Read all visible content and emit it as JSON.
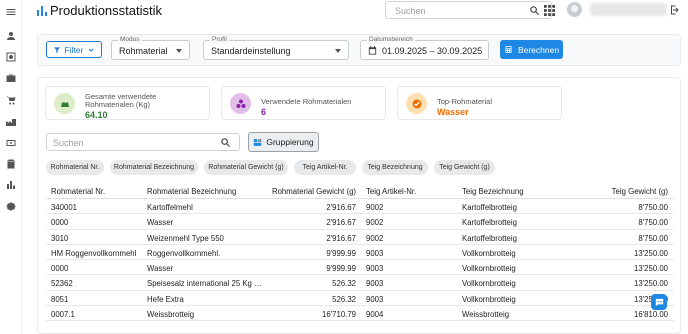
{
  "header": {
    "title": "Produktionsstatistik",
    "search_placeholder": "Suchen"
  },
  "filters": {
    "filter_label": "Filter",
    "modus": {
      "label": "Modus",
      "value": "Rohmaterial"
    },
    "profil": {
      "label": "Profil",
      "value": "Standardeinstellung"
    },
    "datumsbereich": {
      "label": "Datumsbereich",
      "value": "01.09.2025 – 30.09.2025"
    },
    "calculate_label": "Berechnen"
  },
  "stats": [
    {
      "label": "Gesamte verwendete Rohmaterialen (Kg)",
      "value": "64.10",
      "color": "#2e7d32"
    },
    {
      "label": "Verwendete Rohmaterialen",
      "value": "6",
      "color": "#8e24aa"
    },
    {
      "label": "Top-Rohmaterial",
      "value": "Wasser",
      "color": "#ef6c00"
    }
  ],
  "table_search_placeholder": "Suchen",
  "group_label": "Gruppierung",
  "chips": [
    "Rohmaterial Nr.",
    "Rohmaterial Bezeichnung",
    "Rohmaterial Gewicht (g)",
    "Teig Artikel-Nr.",
    "Teig Bezeichnung",
    "Teig Gewicht (g)"
  ],
  "table": {
    "columns": [
      "Rohmaterial Nr.",
      "Rohmaterial Bezeichnung",
      "Rohmaterial Gewicht (g)",
      "Teig Artikel-Nr.",
      "Teig Bezeichnung",
      "Teig Gewicht (g)"
    ],
    "rows": [
      [
        "340001",
        "Kartoffelmehl",
        "2'916.67",
        "9002",
        "Kartoffelbrotteig",
        "8'750.00"
      ],
      [
        "0000",
        "Wasser",
        "2'916.67",
        "9002",
        "Kartoffelbrotteig",
        "8'750.00"
      ],
      [
        "3010",
        "Weizenmehl Type 550",
        "2'916.67",
        "9002",
        "Kartoffelbrotteig",
        "8'750.00"
      ],
      [
        "HM Roggenvollkornmehl",
        "Roggenvollkornmehl.",
        "9'999.99",
        "9003",
        "Vollkornbrotteig",
        "13'250.00"
      ],
      [
        "0000",
        "Wasser",
        "9'999.99",
        "9003",
        "Vollkornbrotteig",
        "13'250.00"
      ],
      [
        "52362",
        "Speisesalz international 25 Kg Ku...",
        "526.32",
        "9003",
        "Vollkornbrotteig",
        "13'250.00"
      ],
      [
        "8051",
        "Hefe Extra",
        "526.32",
        "9003",
        "Vollkornbrotteig",
        "13'250.00"
      ],
      [
        "0007.1",
        "Weissbrotteig",
        "16'710.79",
        "9004",
        "Weissbrotteig",
        "16'810.00"
      ]
    ]
  },
  "colors": {
    "accent": "#1e88e5"
  }
}
